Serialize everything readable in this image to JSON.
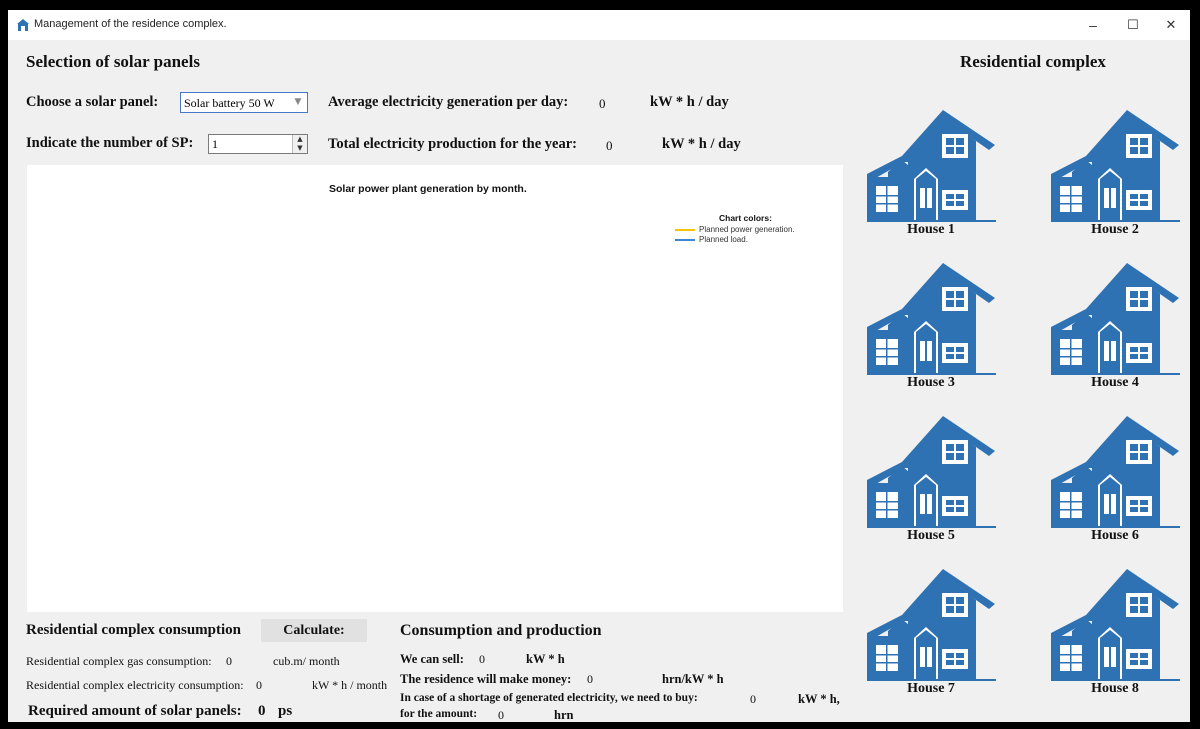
{
  "window": {
    "title": "Management of the residence complex.",
    "minimize": "–",
    "maximize": "☐",
    "close": "✕"
  },
  "panel_selection": {
    "heading": "Selection of solar panels",
    "choose_label": "Choose a solar panel:",
    "choose_value": "Solar battery 50 W",
    "count_label": "Indicate the number of SP:",
    "count_value": "1",
    "avg_label": "Average electricity generation per day:",
    "avg_value": "0",
    "avg_unit": "kW * h / day",
    "total_label": "Total electricity production for the year:",
    "total_value": "0",
    "total_unit": "kW * h / day"
  },
  "chart": {
    "title": "Solar power plant generation by month.",
    "legend_title": "Chart colors:",
    "legend": [
      {
        "label": "Planned power generation.",
        "color": "#f5c400"
      },
      {
        "label": "Planned load.",
        "color": "#3a86d8"
      }
    ]
  },
  "consumption": {
    "heading": "Residential complex consumption",
    "calculate_label": "Calculate:",
    "gas_label": "Residential complex gas consumption:",
    "gas_value": "0",
    "gas_unit": "cub.m/ month",
    "elec_label": "Residential complex electricity consumption:",
    "elec_value": "0",
    "elec_unit": "kW * h / month",
    "required_label": "Required amount of solar panels:",
    "required_value": "0",
    "required_unit": "ps"
  },
  "production": {
    "heading": "Consumption and production",
    "sell_label": "We can sell:",
    "sell_value": "0",
    "sell_unit": "kW * h",
    "money_label": "The residence will make money:",
    "money_value": "0",
    "money_unit": "hrn/kW * h",
    "shortage_label": "In case of a shortage of generated electricity, we need to buy:",
    "shortage_value": "0",
    "shortage_unit": "kW * h,",
    "amount_label": "for the amount:",
    "amount_value": "0",
    "amount_unit": "hrn"
  },
  "complex": {
    "heading": "Residential complex",
    "house_color": "#2f72b3",
    "houses": [
      "House 1",
      "House 2",
      "House 3",
      "House 4",
      "House 5",
      "House 6",
      "House 7",
      "House 8"
    ]
  }
}
